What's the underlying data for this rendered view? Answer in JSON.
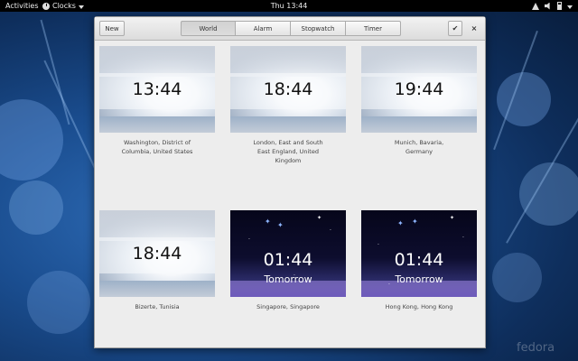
{
  "topbar": {
    "activities": "Activities",
    "app_menu": "Clocks",
    "clock": "Thu 13:44"
  },
  "headerbar": {
    "new_label": "New",
    "tabs": [
      {
        "label": "World"
      },
      {
        "label": "Alarm"
      },
      {
        "label": "Stopwatch"
      },
      {
        "label": "Timer"
      }
    ],
    "check_label": "✔",
    "close_label": "×"
  },
  "clocks": [
    {
      "time": "13:44",
      "day": "",
      "city": "Washington, District of Columbia, United States"
    },
    {
      "time": "18:44",
      "day": "",
      "city": "London, East and South East England, United Kingdom"
    },
    {
      "time": "19:44",
      "day": "",
      "city": "Munich, Bavaria, Germany"
    },
    {
      "time": "18:44",
      "day": "",
      "city": "Bizerte, Tunisia"
    },
    {
      "time": "01:44",
      "day": "Tomorrow",
      "city": "Singapore, Singapore"
    },
    {
      "time": "01:44",
      "day": "Tomorrow",
      "city": "Hong Kong, Hong Kong"
    }
  ],
  "wallpaper": {
    "watermark": "fedora"
  }
}
